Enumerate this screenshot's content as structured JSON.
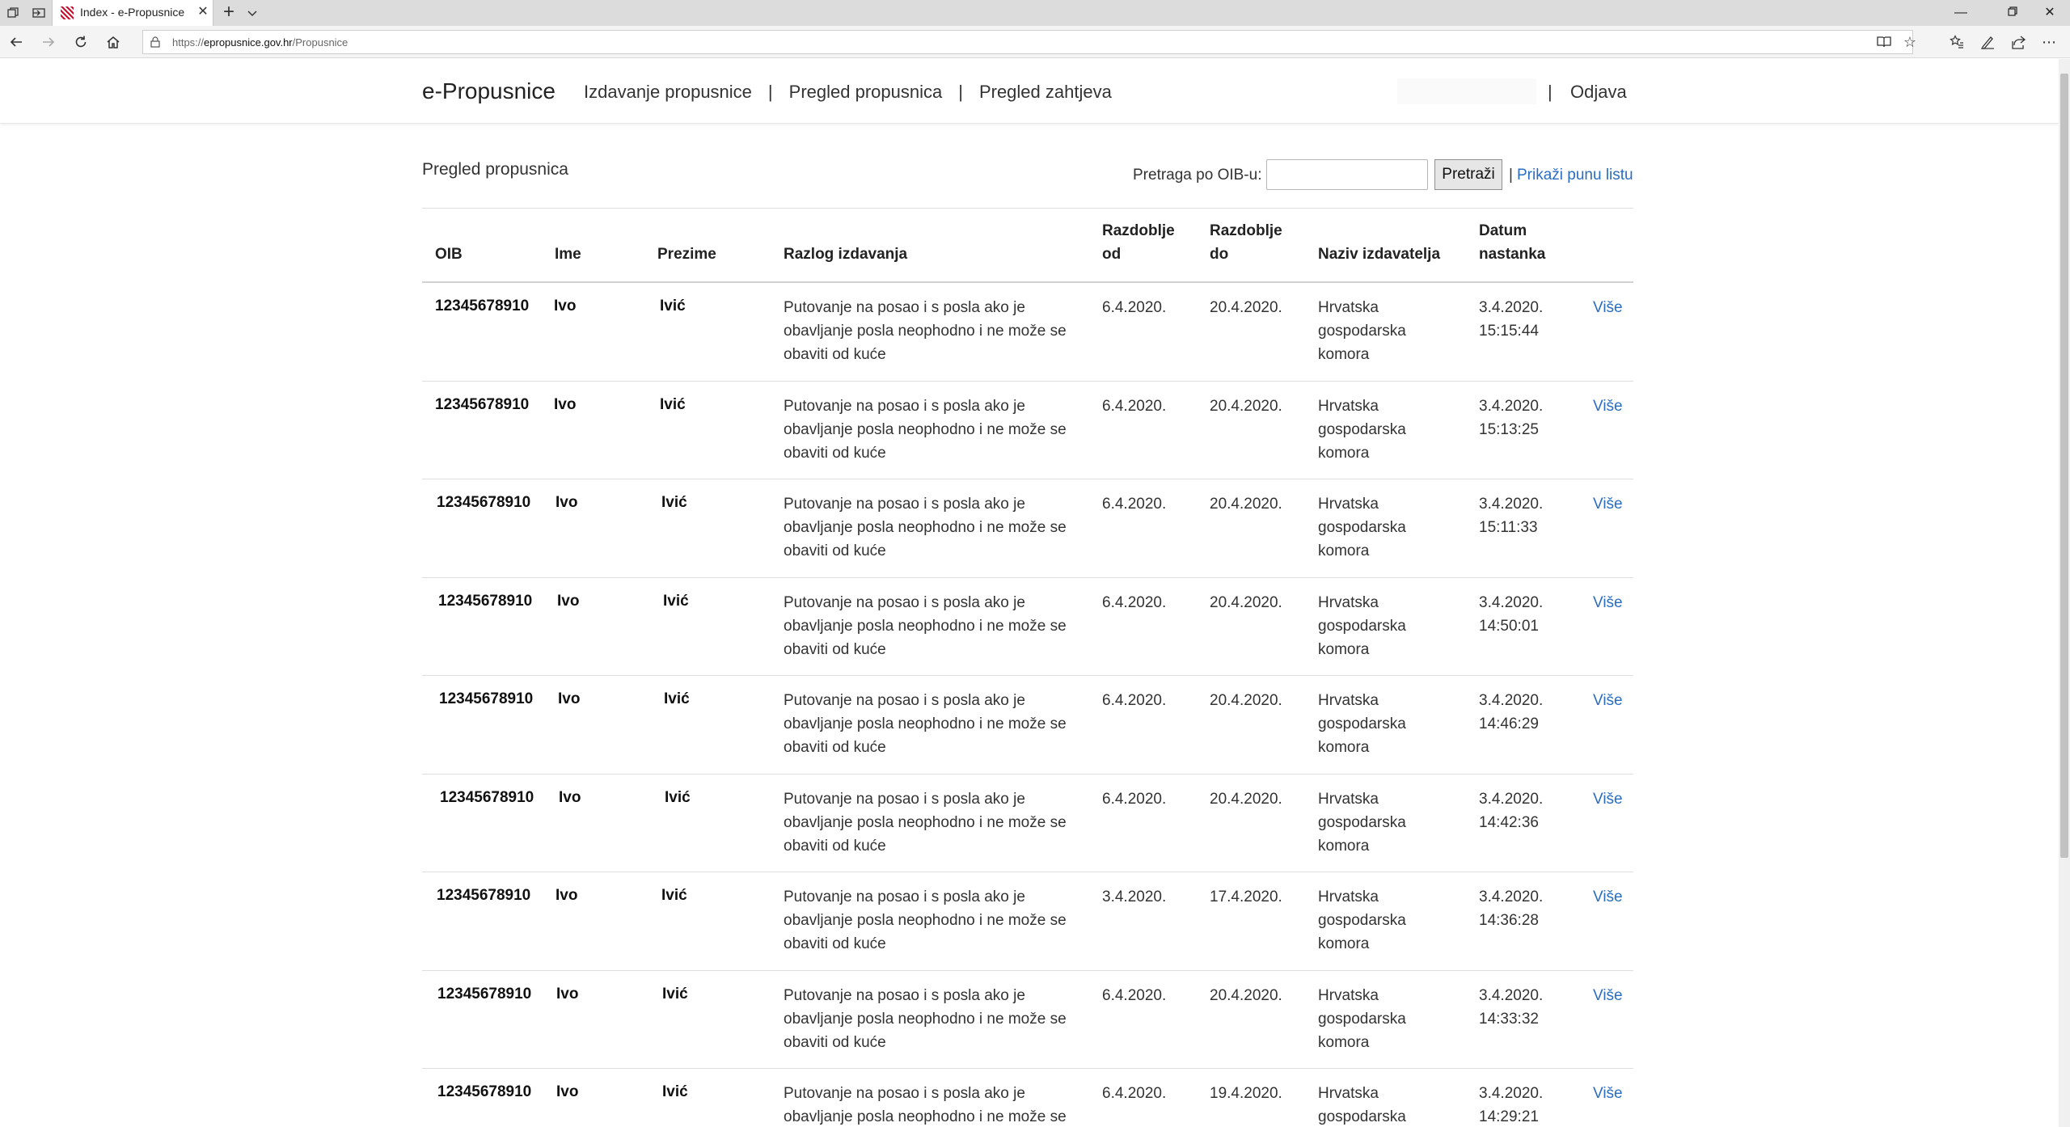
{
  "browser": {
    "tab_title": "Index - e-Propusnice",
    "url_scheme": "https://",
    "url_host": "epropusnice.gov.hr",
    "url_path": "/Propusnice"
  },
  "header": {
    "brand": "e-Propusnice",
    "nav": [
      "Izdavanje propusnice",
      "Pregled propusnica",
      "Pregled zahtjeva"
    ],
    "separator": "|",
    "logout": "Odjava"
  },
  "page": {
    "title": "Pregled propusnica",
    "search_label": "Pretraga po OIB-u:",
    "search_value": "",
    "search_button": "Pretraži",
    "show_all_separator": "|",
    "show_all": "Prikaži punu listu"
  },
  "table": {
    "headers": {
      "oib": "OIB",
      "ime": "Ime",
      "prezime": "Prezime",
      "razlog": "Razlog izdavanja",
      "od_1": "Razdoblje",
      "od_2": "od",
      "do_1": "Razdoblje",
      "do_2": "do",
      "izdavatelj": "Naziv izdavatelja",
      "datum_1": "Datum",
      "datum_2": "nastanka"
    },
    "reason_lines": [
      "Putovanje na posao i s posla ako je",
      "obavljanje posla neophodno i ne može se",
      "obaviti od kuće"
    ],
    "issuer_lines": [
      "Hrvatska",
      "gospodarska",
      "komora"
    ],
    "more_label": "Više",
    "rows": [
      {
        "oib": "12345678910",
        "ime": "Ivo",
        "prezime": "Ivić",
        "od": "6.4.2020.",
        "do": "20.4.2020.",
        "datum": "3.4.2020.",
        "vrijeme": "15:15:44"
      },
      {
        "oib": "12345678910",
        "ime": "Ivo",
        "prezime": "Ivić",
        "od": "6.4.2020.",
        "do": "20.4.2020.",
        "datum": "3.4.2020.",
        "vrijeme": "15:13:25"
      },
      {
        "oib": "12345678910",
        "ime": "Ivo",
        "prezime": "Ivić",
        "od": "6.4.2020.",
        "do": "20.4.2020.",
        "datum": "3.4.2020.",
        "vrijeme": "15:11:33"
      },
      {
        "oib": "12345678910",
        "ime": "Ivo",
        "prezime": "Ivić",
        "od": "6.4.2020.",
        "do": "20.4.2020.",
        "datum": "3.4.2020.",
        "vrijeme": "14:50:01"
      },
      {
        "oib": "12345678910",
        "ime": "Ivo",
        "prezime": "Ivić",
        "od": "6.4.2020.",
        "do": "20.4.2020.",
        "datum": "3.4.2020.",
        "vrijeme": "14:46:29"
      },
      {
        "oib": "12345678910",
        "ime": "Ivo",
        "prezime": "Ivić",
        "od": "6.4.2020.",
        "do": "20.4.2020.",
        "datum": "3.4.2020.",
        "vrijeme": "14:42:36"
      },
      {
        "oib": "12345678910",
        "ime": "Ivo",
        "prezime": "Ivić",
        "od": "3.4.2020.",
        "do": "17.4.2020.",
        "datum": "3.4.2020.",
        "vrijeme": "14:36:28"
      },
      {
        "oib": "12345678910",
        "ime": "Ivo",
        "prezime": "Ivić",
        "od": "6.4.2020.",
        "do": "20.4.2020.",
        "datum": "3.4.2020.",
        "vrijeme": "14:33:32"
      },
      {
        "oib": "12345678910",
        "ime": "Ivo",
        "prezime": "Ivić",
        "od": "6.4.2020.",
        "do": "19.4.2020.",
        "datum": "3.4.2020.",
        "vrijeme": "14:29:21"
      }
    ]
  }
}
